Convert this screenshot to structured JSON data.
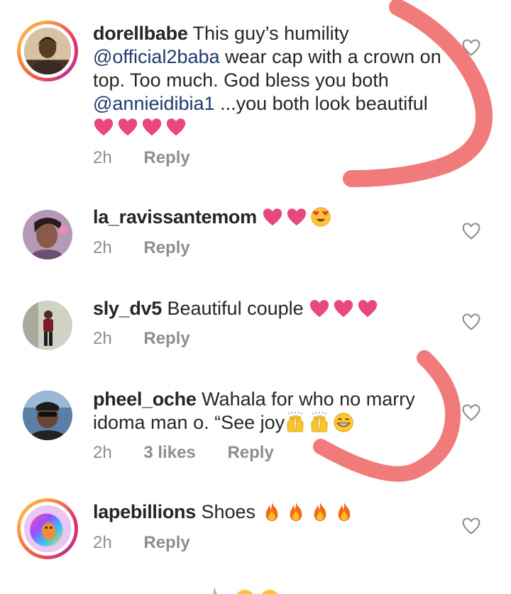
{
  "comments": [
    {
      "username": "dorellbabe",
      "text_1": "This guy’s humility",
      "mention_1": "@official2baba",
      "text_2": "wear cap with a crown on top. Too much. God bless you both",
      "mention_2": "@annieidibia1",
      "text_3": "...you both look beautiful",
      "emojis": [
        "pink-heart-emoji",
        "pink-heart-emoji",
        "pink-heart-emoji",
        "pink-heart-emoji"
      ],
      "time": "2h",
      "reply_label": "Reply",
      "avatar_ring": true
    },
    {
      "username": "la_ravissantemom",
      "text": "",
      "emojis": [
        "pink-heart-emoji",
        "pink-heart-emoji",
        "heart-eyes-emoji"
      ],
      "time": "2h",
      "reply_label": "Reply",
      "avatar_ring": false
    },
    {
      "username": "sly_dv5",
      "text": "Beautiful couple",
      "emojis": [
        "pink-heart-emoji",
        "pink-heart-emoji",
        "pink-heart-emoji"
      ],
      "time": "2h",
      "reply_label": "Reply",
      "avatar_ring": false
    },
    {
      "username": "pheel_oche",
      "text": "Wahala for who no marry idoma man o. “See joy",
      "emojis": [
        "raising-hands-emoji",
        "raising-hands-emoji",
        "grinning-emoji"
      ],
      "time": "2h",
      "likes": "3 likes",
      "reply_label": "Reply",
      "avatar_ring": false
    },
    {
      "username": "lapebillions",
      "text": "Shoes",
      "emojis": [
        "fire-emoji",
        "fire-emoji",
        "fire-emoji",
        "fire-emoji"
      ],
      "time": "2h",
      "reply_label": "Reply",
      "avatar_ring": true
    }
  ],
  "colors": {
    "text": "#262626",
    "meta": "#8e8e8e",
    "mention": "#1f3b6e",
    "heart": "#e8487f",
    "marker": "#f07070"
  }
}
